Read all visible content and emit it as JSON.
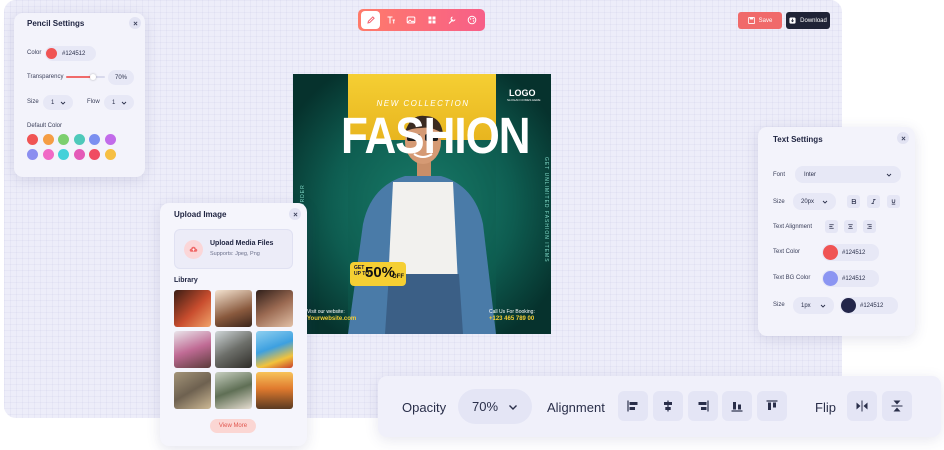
{
  "toolbar": {
    "tools": [
      "pencil-icon",
      "text-icon",
      "image-icon",
      "grid-icon",
      "tools-icon",
      "palette-icon"
    ],
    "save_label": "Save",
    "download_label": "Download"
  },
  "pencil_settings": {
    "title": "Pencil Settings",
    "color_label": "Color",
    "color_value": "#124512",
    "transparency_label": "Transparency",
    "transparency_value": "70%",
    "transparency_fraction": 0.7,
    "size_label": "Size",
    "size_value": "1",
    "flow_label": "Flow",
    "flow_value": "1",
    "default_color_label": "Default Color",
    "default_colors": [
      "#f05454",
      "#f59d44",
      "#7ccf6e",
      "#4ec9ba",
      "#7b8ff0",
      "#c26bea",
      "#8b8ef0",
      "#f06ac6",
      "#43d1d9",
      "#e45ab8",
      "#f04c62",
      "#f6bf43"
    ]
  },
  "poster": {
    "headline_small": "NEW COLLECTION",
    "headline_big": "FASHION",
    "logo": "LOGO",
    "logo_sub": "SLOGAN COMES HERE",
    "side_text_left": "50% OFF ON ONLINE ORDER",
    "side_text_right": "GET UNLIMITED FASHION ITEMS",
    "badge_get": "GET",
    "badge_upto": "UP TO",
    "badge_percent": "50%",
    "badge_off": "OFF",
    "visit_label": "Visit our website:",
    "website": "Yourwebsite.com",
    "call_label": "Call Us For Booking:",
    "phone": "+123 465 789 00"
  },
  "text_settings": {
    "title": "Text Settings",
    "font_label": "Font",
    "font_value": "Inter",
    "size_label": "Size",
    "size_value": "20px",
    "alignment_label": "Text Alignment",
    "text_color_label": "Text Color",
    "text_color_value": "#124512",
    "text_bg_label": "Text BG Color",
    "text_bg_value": "#124512",
    "stroke_size_label": "Size",
    "stroke_size_value": "1px",
    "stroke_color_value": "#124512"
  },
  "upload": {
    "title": "Upload Image",
    "drop_title": "Upload Media Files",
    "drop_sub": "Supports: Jpeg, Png",
    "library_label": "Library",
    "view_more": "View More"
  },
  "bottom_bar": {
    "opacity_label": "Opacity",
    "opacity_value": "70%",
    "alignment_label": "Alignment",
    "flip_label": "Flip"
  },
  "colors": {
    "accent": "#f06a6a",
    "dark": "#1f2336",
    "panel": "#f3f3fb",
    "canvas": "#ededf9"
  }
}
